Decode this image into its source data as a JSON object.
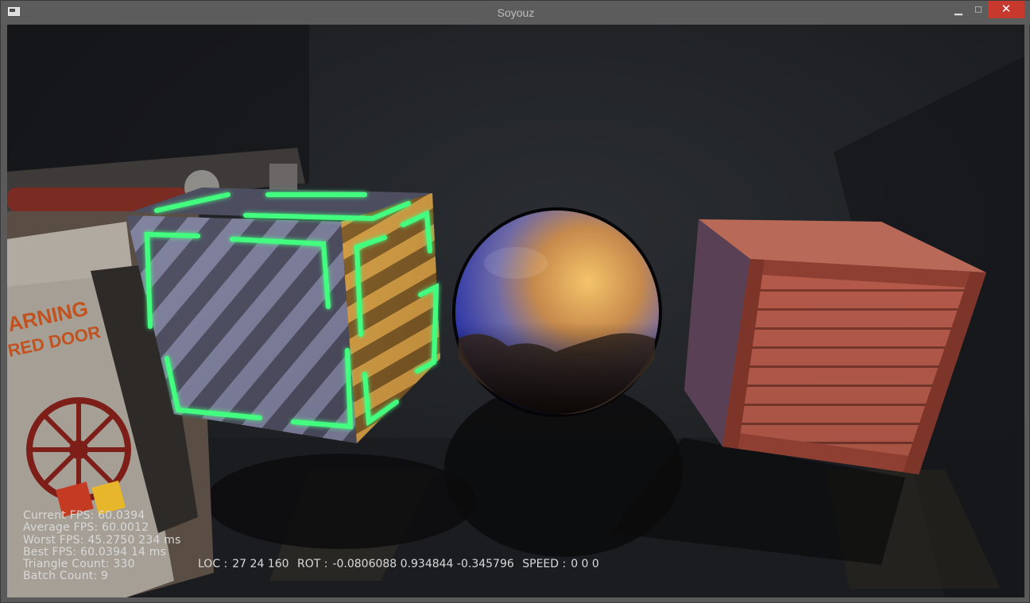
{
  "window": {
    "title": "Soyouz",
    "minimize_glyph": "▁",
    "maximize_glyph": "□",
    "close_glyph": "✕"
  },
  "colors": {
    "titlebar": "#5c5c5c",
    "close": "#c7392c",
    "neon": "#3cff7a",
    "sign_text": "#c2521f"
  },
  "scene": {
    "sign_line1": "ARNING",
    "sign_line2": "RED DOOR",
    "objects": [
      "warning-panel",
      "neon-cube",
      "reflective-sphere",
      "wooden-crate"
    ]
  },
  "stats": {
    "current_fps": "Current FPS: 60.0394",
    "average_fps": "Average FPS: 60.0012",
    "worst_fps": "Worst FPS: 45.2750 234 ms",
    "best_fps": "Best FPS: 60.0394 14 ms",
    "triangle_count": "Triangle Count: 330",
    "batch_count": "Batch Count: 9"
  },
  "camera": {
    "loc_label": "LOC :",
    "loc_value": "27 24 160",
    "rot_label": "ROT :",
    "rot_value": "-0.0806088 0.934844 -0.345796",
    "speed_label": "SPEED :",
    "speed_value": "0 0 0"
  }
}
